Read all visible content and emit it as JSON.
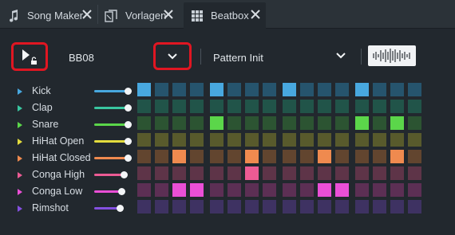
{
  "tabs": [
    {
      "label": "Song Maker",
      "icon": "music-note-icon",
      "active": false
    },
    {
      "label": "Vorlagen",
      "icon": "template-icon",
      "active": false
    },
    {
      "label": "Beatbox",
      "icon": "grid-icon",
      "active": true
    }
  ],
  "toolbar": {
    "pattern_name": "BB08",
    "preset_name": "Pattern Init"
  },
  "instruments": [
    {
      "name": "Kick",
      "color": "#48a8df",
      "volume": 1.0
    },
    {
      "name": "Clap",
      "color": "#39c6a0",
      "volume": 1.0
    },
    {
      "name": "Snare",
      "color": "#5bd64a",
      "volume": 1.0
    },
    {
      "name": "HiHat Open",
      "color": "#e3dc3e",
      "volume": 1.0
    },
    {
      "name": "HiHat Closed",
      "color": "#ef8a4f",
      "volume": 1.0
    },
    {
      "name": "Conga High",
      "color": "#ec5b94",
      "volume": 0.87
    },
    {
      "name": "Conga Low",
      "color": "#ea4fd6",
      "volume": 0.81
    },
    {
      "name": "Rimshot",
      "color": "#8450e0",
      "volume": 0.76
    }
  ],
  "grid": {
    "steps": 16,
    "active": [
      [
        0,
        4,
        8,
        12
      ],
      [],
      [
        4,
        12,
        14
      ],
      [],
      [
        2,
        6,
        10,
        14
      ],
      [
        6
      ],
      [
        2,
        3,
        10,
        11
      ],
      []
    ],
    "cell_colors": [
      "#26546d",
      "#215449",
      "#2c5432",
      "#585a2c",
      "#62452f",
      "#5e3448",
      "#5c2f54",
      "#3e3262"
    ]
  }
}
